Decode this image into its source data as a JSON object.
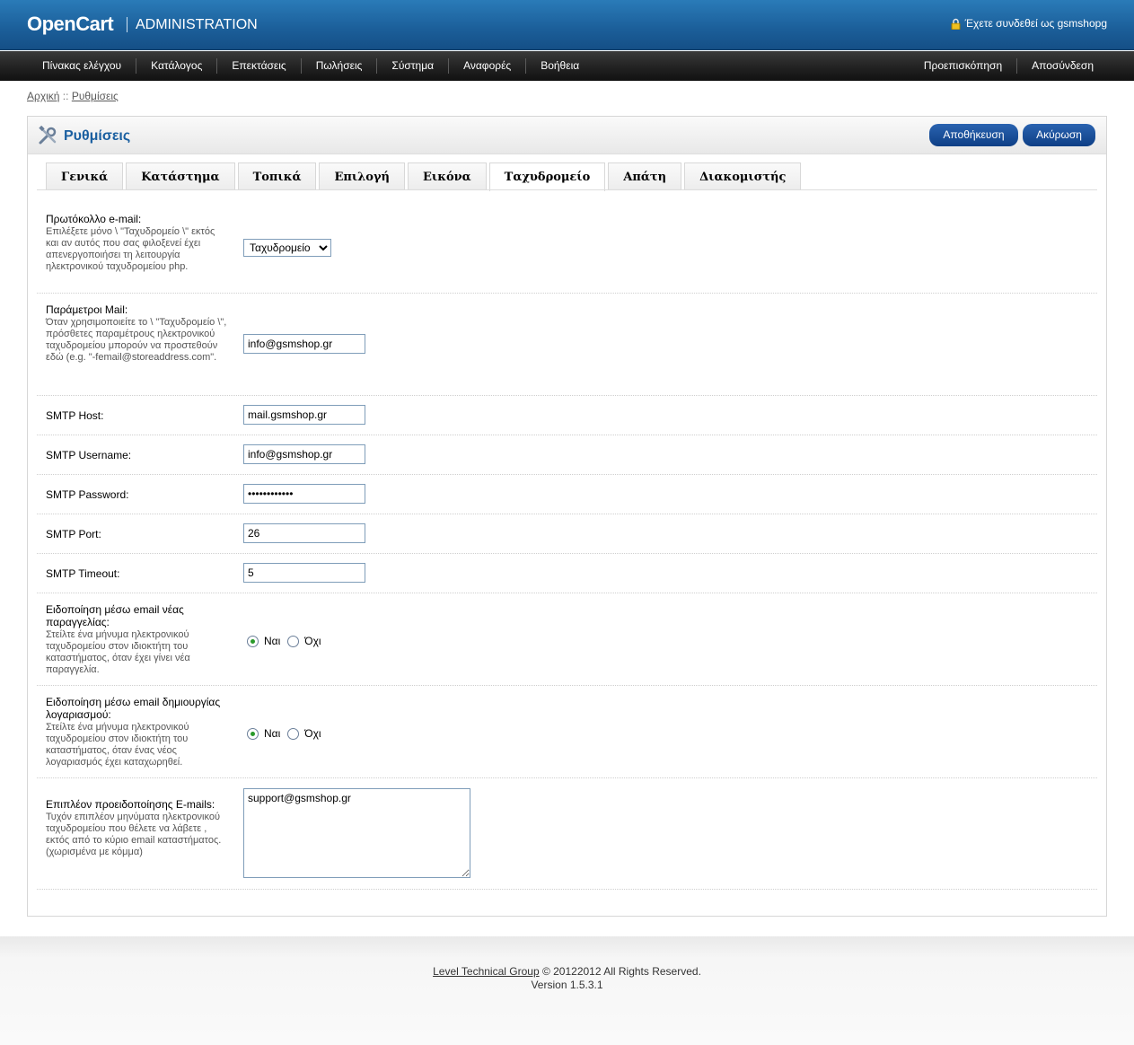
{
  "header": {
    "logo": "OpenCart",
    "admin_label": "ADMINISTRATION",
    "logged_in_text": "Έχετε συνδεθεί ως gsmshopg"
  },
  "menu": {
    "left": [
      "Πίνακας ελέγχου",
      "Κατάλογος",
      "Επεκτάσεις",
      "Πωλήσεις",
      "Σύστημα",
      "Αναφορές",
      "Βοήθεια"
    ],
    "right": [
      "Προεπισκόπηση",
      "Αποσύνδεση"
    ]
  },
  "breadcrumb": {
    "home": "Αρχική",
    "separator": " :: ",
    "current": "Ρυθμίσεις"
  },
  "page": {
    "title": "Ρυθμίσεις",
    "save_label": "Αποθήκευση",
    "cancel_label": "Ακύρωση"
  },
  "tabs": {
    "items": [
      "Γενικά",
      "Κατάστημα",
      "Τοπικά",
      "Επιλογή",
      "Εικόνα",
      "Ταχυδρομείο",
      "Απάτη",
      "Διακομιστής"
    ],
    "active_index": 5
  },
  "form": {
    "mail_protocol": {
      "label": "Πρωτόκολλο e-mail:",
      "help": "Επιλέξετε μόνο \\ \"Ταχυδρομείο \\\" εκτός και αν αυτός που σας φιλοξενεί έχει απενεργοποιήσει τη λειτουργία ηλεκτρονικού ταχυδρομείου php.",
      "value": "Ταχυδρομείο"
    },
    "mail_parameter": {
      "label": "Παράμετροι Mail:",
      "help": "Όταν χρησιμοποιείτε το \\ \"Ταχυδρομείο \\\", πρόσθετες παραμέτρους ηλεκτρονικού ταχυδρομείου μπορούν να προστεθούν εδώ (e.g. \"-femail@storeaddress.com\".",
      "value": "info@gsmshop.gr"
    },
    "smtp_host": {
      "label": "SMTP Host:",
      "value": "mail.gsmshop.gr"
    },
    "smtp_username": {
      "label": "SMTP Username:",
      "value": "info@gsmshop.gr"
    },
    "smtp_password": {
      "label": "SMTP Password:",
      "value": "gsmshop-pass"
    },
    "smtp_port": {
      "label": "SMTP Port:",
      "value": "26"
    },
    "smtp_timeout": {
      "label": "SMTP Timeout:",
      "value": "5"
    },
    "alert_mail": {
      "label": "Ειδοποίηση μέσω email νέας παραγγελίας:",
      "help": "Στείλτε ένα μήνυμα ηλεκτρονικού ταχυδρομείου στον ιδιοκτήτη του καταστήματος, όταν έχει γίνει νέα παραγγελία.",
      "yes": "Ναι",
      "no": "Όχι",
      "selected": "yes"
    },
    "account_mail": {
      "label": "Ειδοποίηση μέσω email δημιουργίας λογαριασμού:",
      "help": "Στείλτε ένα μήνυμα ηλεκτρονικού ταχυδρομείου στον ιδιοκτήτη του καταστήματος, όταν ένας νέος λογαριασμός έχει καταχωρηθεί.",
      "yes": "Ναι",
      "no": "Όχι",
      "selected": "yes"
    },
    "alert_emails": {
      "label": "Επιπλέον προειδοποίησης E-mails:",
      "help": "Τυχόν επιπλέον μηνύματα ηλεκτρονικού ταχυδρομείου που θέλετε να λάβετε , εκτός από το κύριο email καταστήματος. (χωρισμένα με κόμμα)",
      "value": "support@gsmshop.gr"
    }
  },
  "footer": {
    "link": "Level Technical Group",
    "copyright": " © 20122012 All Rights Reserved.",
    "version": "Version 1.5.3.1"
  },
  "colors": {
    "header": "#1b5e99",
    "title": "#1a5fa0",
    "button": "#0e3f86"
  }
}
